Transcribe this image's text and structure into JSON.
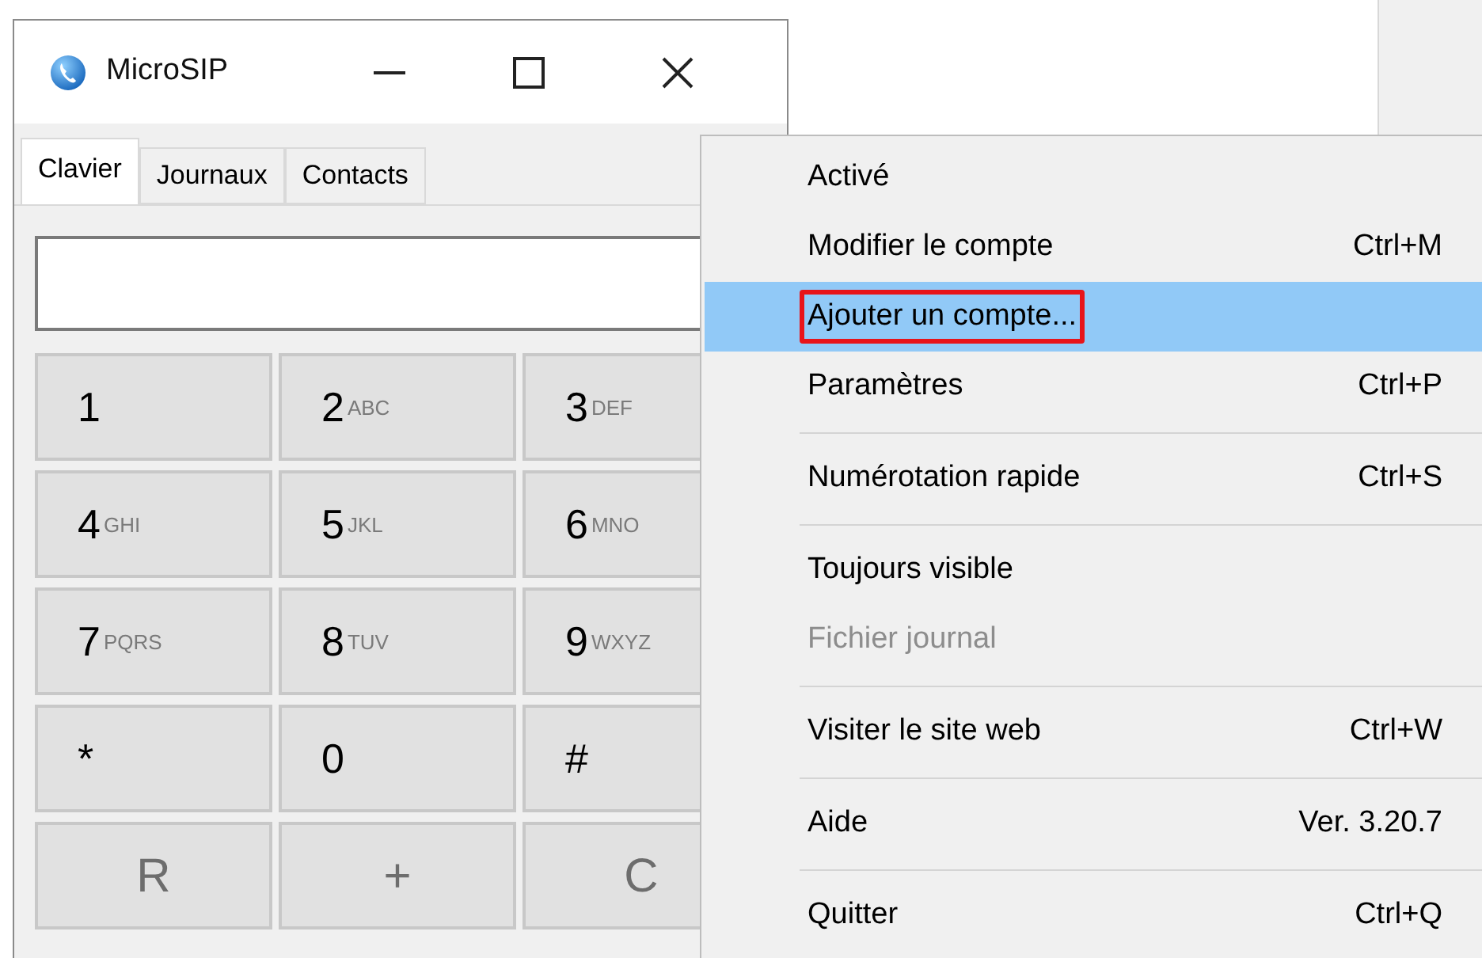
{
  "window": {
    "title": "MicroSIP"
  },
  "tabs": [
    {
      "label": "Clavier",
      "selected": true
    },
    {
      "label": "Journaux",
      "selected": false
    },
    {
      "label": "Contacts",
      "selected": false
    }
  ],
  "keypad": [
    [
      {
        "digit": "1"
      },
      {
        "digit": "2",
        "letters": "ABC"
      },
      {
        "digit": "3",
        "letters": "DEF"
      }
    ],
    [
      {
        "digit": "4",
        "letters": "GHI"
      },
      {
        "digit": "5",
        "letters": "JKL"
      },
      {
        "digit": "6",
        "letters": "MNO"
      }
    ],
    [
      {
        "digit": "7",
        "letters": "PQRS"
      },
      {
        "digit": "8",
        "letters": "TUV"
      },
      {
        "digit": "9",
        "letters": "WXYZ"
      }
    ],
    [
      {
        "digit": "*"
      },
      {
        "digit": "0"
      },
      {
        "digit": "#"
      }
    ]
  ],
  "action_keys": [
    "R",
    "+",
    "C"
  ],
  "menu": [
    {
      "kind": "item",
      "label": "Activé",
      "selected": false,
      "disabled": false,
      "outlined": false
    },
    {
      "kind": "item",
      "label": "Modifier le compte",
      "shortcut": "Ctrl+M",
      "selected": false,
      "disabled": false,
      "outlined": false
    },
    {
      "kind": "item",
      "label": "Ajouter un compte...",
      "selected": true,
      "disabled": false,
      "outlined": true
    },
    {
      "kind": "item",
      "label": "Paramètres",
      "shortcut": "Ctrl+P",
      "selected": false,
      "disabled": false,
      "outlined": false
    },
    {
      "kind": "separator"
    },
    {
      "kind": "item",
      "label": "Numérotation rapide",
      "shortcut": "Ctrl+S",
      "selected": false,
      "disabled": false,
      "outlined": false
    },
    {
      "kind": "separator"
    },
    {
      "kind": "item",
      "label": "Toujours visible",
      "selected": false,
      "disabled": false,
      "outlined": false
    },
    {
      "kind": "item",
      "label": "Fichier journal",
      "selected": false,
      "disabled": true,
      "outlined": false
    },
    {
      "kind": "separator"
    },
    {
      "kind": "item",
      "label": "Visiter le site web",
      "shortcut": "Ctrl+W",
      "selected": false,
      "disabled": false,
      "outlined": false
    },
    {
      "kind": "separator"
    },
    {
      "kind": "item",
      "label": "Aide",
      "shortcut": "Ver. 3.20.7",
      "selected": false,
      "disabled": false,
      "outlined": false
    },
    {
      "kind": "separator"
    },
    {
      "kind": "item",
      "label": "Quitter",
      "shortcut": "Ctrl+Q",
      "selected": false,
      "disabled": false,
      "outlined": false
    }
  ]
}
